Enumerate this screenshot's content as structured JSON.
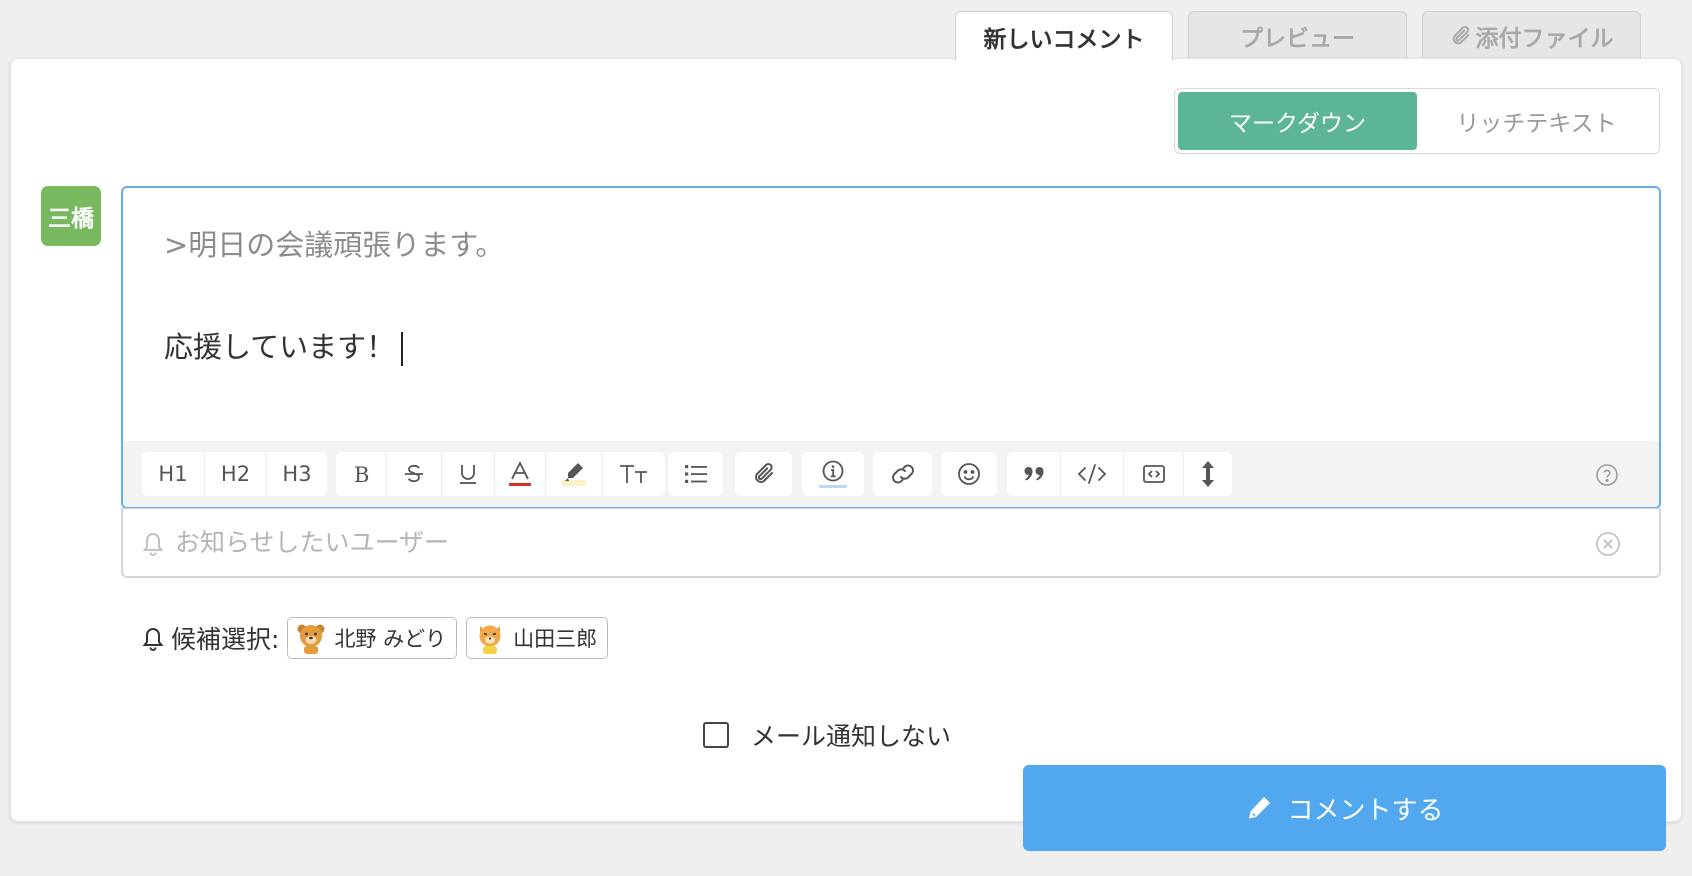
{
  "tabs": [
    {
      "label": "新しいコメント",
      "active": true
    },
    {
      "label": "プレビュー",
      "active": false
    },
    {
      "label": "添付ファイル",
      "active": false,
      "icon": "paperclip-icon"
    }
  ],
  "editor_mode": {
    "markdown": "マークダウン",
    "richtext": "リッチテキスト",
    "selected": "markdown"
  },
  "avatar": {
    "text": "三橋",
    "color": "#78b85e"
  },
  "editor": {
    "quote_line": ">明日の会議頑張ります。",
    "body_line": "応援しています！"
  },
  "toolbar": {
    "h1": "H1",
    "h2": "H2",
    "h3": "H3",
    "icons": [
      "bold-icon",
      "strikethrough-icon",
      "underline-icon",
      "text-color-icon",
      "highlight-icon",
      "font-size-icon",
      "bullet-list-icon",
      "attachment-icon",
      "info-icon",
      "link-icon",
      "emoji-icon",
      "quote-icon",
      "code-icon",
      "code-block-icon",
      "resize-icon",
      "help-icon"
    ]
  },
  "notify": {
    "placeholder": "お知らせしたいユーザー"
  },
  "candidates": {
    "label": "候補選択:",
    "users": [
      {
        "name": "北野 みどり",
        "icon": "bear-avatar-icon"
      },
      {
        "name": "山田三郎",
        "icon": "cat-avatar-icon"
      }
    ]
  },
  "mail_option": {
    "label": "メール通知しない",
    "checked": false
  },
  "submit": {
    "label": "コメントする"
  },
  "colors": {
    "accent_green": "#5db597",
    "submit_blue": "#52a8ef",
    "focus_blue": "#66adee"
  }
}
